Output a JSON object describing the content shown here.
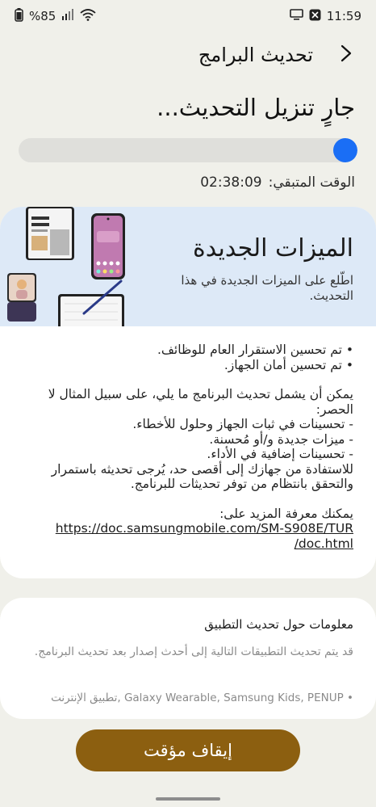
{
  "status_bar": {
    "battery": "%85",
    "time": "11:59",
    "icons": [
      "battery-icon",
      "signal-icon",
      "wifi-icon",
      "screen-cast-icon",
      "nfc-icon"
    ]
  },
  "header": {
    "title": "تحديث البرامج",
    "back_icon": "chevron-right-icon"
  },
  "download": {
    "title": "جارٍ تنزيل التحديث...",
    "progress_fraction": 0.03,
    "remaining_label": "الوقت المتبقي:",
    "remaining_time": "02:38:09"
  },
  "features": {
    "title": "الميزات الجديدة",
    "subtitle": "اطّلع على الميزات الجديدة في هذا التحديث.",
    "bullets": [
      "• تم تحسين الاستقرار العام للوظائف.",
      "• تم تحسين أمان الجهاز."
    ],
    "intro": "يمكن أن يشمل تحديث البرنامج ما يلي، على سبيل المثال لا الحصر:",
    "items": [
      "- تحسينات في ثبات الجهاز وحلول للأخطاء.",
      "- ميزات جديدة و/أو مُحسنة.",
      "- تحسينات إضافية في الأداء."
    ],
    "advice": "للاستفادة من جهازك إلى أقصى حد، يُرجى تحديثه باستمرار والتحقق بانتظام من توفر تحديثات للبرنامج.",
    "more_label": "يمكنك معرفة المزيد على:",
    "link_line1": "https://doc.samsungmobile.com/SM-S908E/TUR",
    "link_line2": "/doc.html"
  },
  "app_info": {
    "title": "معلومات حول تحديث التطبيق",
    "description": "قد يتم تحديث التطبيقات التالية إلى أحدث إصدار بعد تحديث البرنامج.",
    "apps": "• Galaxy Wearable, Samsung Kids, PENUP ,تطبيق الإنترنت"
  },
  "pause_button": {
    "label": "إيقاف مؤقت"
  },
  "colors": {
    "accent_blue": "#1a6ef5",
    "button_brown": "#8c5f10",
    "background": "#f0f0ea",
    "banner": "#dde9f7"
  }
}
